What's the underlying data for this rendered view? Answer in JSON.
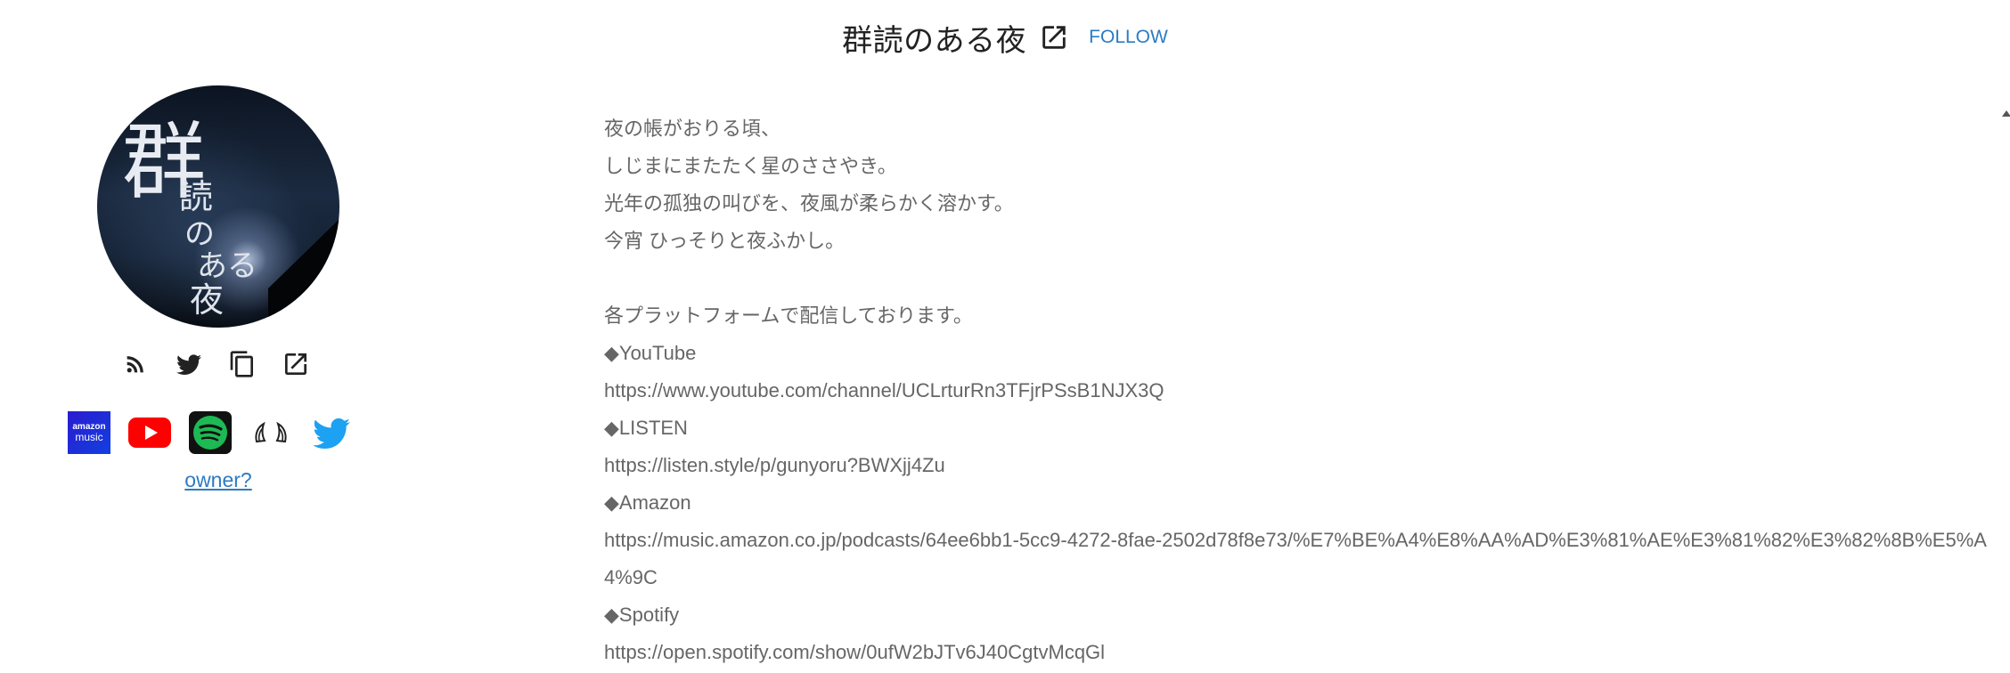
{
  "header": {
    "title": "群読のある夜",
    "external_icon": "open-external-icon",
    "follow_label": "FOLLOW",
    "accent_color": "#2b7bc4"
  },
  "avatar": {
    "big_char": "群",
    "vertical_text": [
      "読",
      "の",
      "あ",
      "る",
      "夜"
    ],
    "vertical_text_first": "読",
    "vertical_text_second": "の",
    "vertical_text_third": "ある",
    "vertical_text_fourth": "夜"
  },
  "actions": {
    "icons": [
      "rss-icon",
      "twitter-icon",
      "copy-icon",
      "open-external-icon"
    ]
  },
  "platforms": {
    "amazon_top": "amazon",
    "amazon_bottom": "music",
    "icons": [
      "amazon-music-icon",
      "youtube-icon",
      "spotify-icon",
      "listen-icon",
      "twitter-icon"
    ],
    "colors": {
      "youtube": "#ff0000",
      "spotify": "#1db954",
      "twitter": "#1da1f2",
      "amazon": "#1b2bd6"
    }
  },
  "owner_link": "owner?",
  "description": {
    "lines": [
      "夜の帳がおりる頃、",
      "しじまにまたたく星のささやき。",
      "光年の孤独の叫びを、夜風が柔らかく溶かす。",
      "今宵 ひっそりと夜ふかし。",
      "",
      "各プラットフォームで配信しております。",
      "◆YouTube",
      "https://www.youtube.com/channel/UCLrturRn3TFjrPSsB1NJX3Q",
      "◆LISTEN",
      "https://listen.style/p/gunyoru?BWXjj4Zu",
      "◆Amazon",
      "https://music.amazon.co.jp/podcasts/64ee6bb1-5cc9-4272-8fae-2502d78f8e73/%E7%BE%A4%E8%AA%AD%E3%81%AE%E3%81%82%E3%82%8B%E5%A4%9C",
      "◆Spotify",
      "https://open.spotify.com/show/0ufW2bJTv6J40CgtvMcqGl"
    ]
  }
}
